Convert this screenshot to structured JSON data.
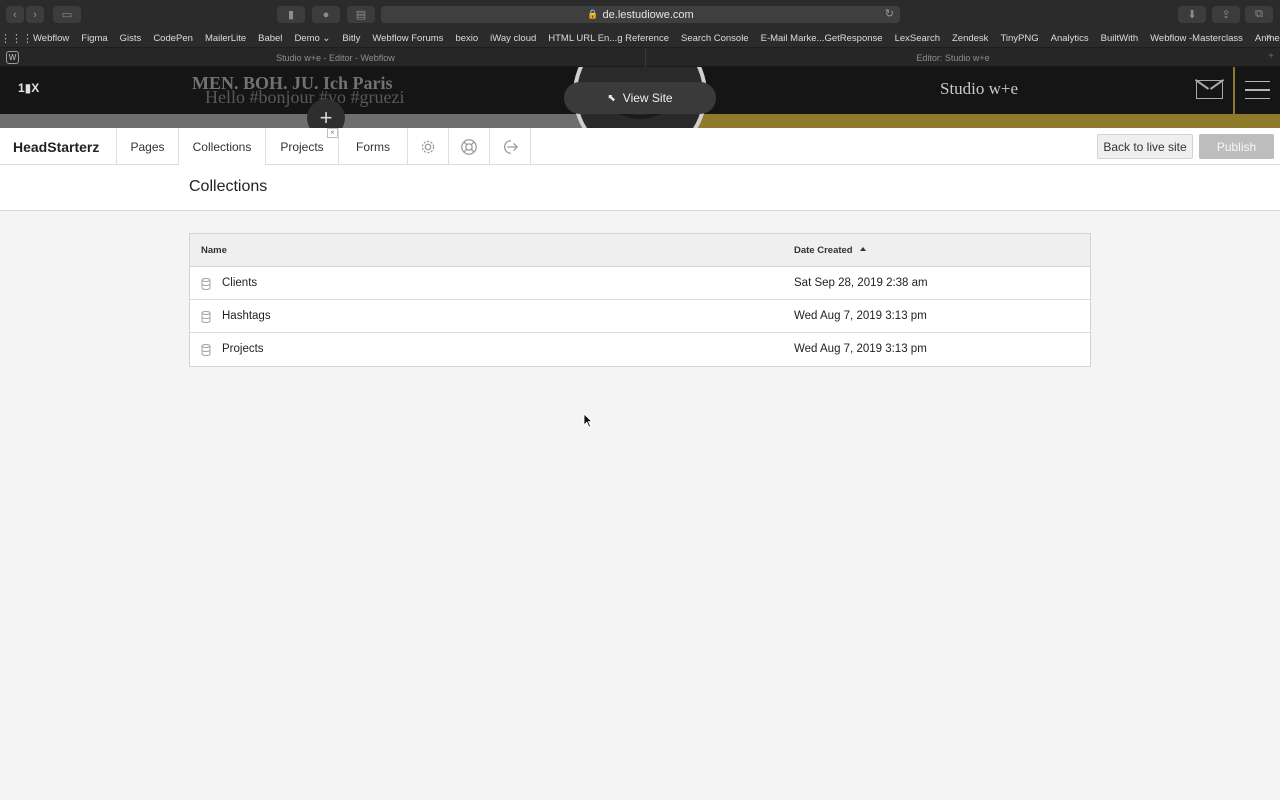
{
  "browser": {
    "url": "de.lestudiowe.com",
    "favorites": [
      "Webflow",
      "Figma",
      "Gists",
      "CodePen",
      "MailerLite",
      "Babel",
      "Demo",
      "Bitly",
      "Webflow Forums",
      "bexio",
      "iWay cloud",
      "HTML URL En...g Reference",
      "Search Console",
      "E-Mail Marke...GetResponse",
      "LexSearch",
      "Zendesk",
      "TinyPNG",
      "Analytics",
      "BuiltWith",
      "Webflow -Masterclass",
      "Anmelden"
    ],
    "tabs": [
      "Studio w+e - Editor - Webflow",
      "Editor: Studio w+e"
    ]
  },
  "site": {
    "logo": "1▮X",
    "overlap_a": "MEN. BOH. JU. Ich Paris",
    "overlap_b": "Hello #bonjour #vo #gruezi",
    "view_site": "View Site",
    "title": "Studio w+e"
  },
  "editor": {
    "brand": "HeadStarterz",
    "tabs": {
      "pages": "Pages",
      "collections": "Collections",
      "projects": "Projects",
      "forms": "Forms"
    },
    "back_to_live": "Back to live site",
    "publish": "Publish"
  },
  "page": {
    "title": "Collections"
  },
  "table": {
    "columns": {
      "name": "Name",
      "date": "Date Created"
    },
    "rows": [
      {
        "name": "Clients",
        "date": "Sat Sep 28, 2019 2:38 am"
      },
      {
        "name": "Hashtags",
        "date": "Wed Aug 7, 2019 3:13 pm"
      },
      {
        "name": "Projects",
        "date": "Wed Aug 7, 2019 3:13 pm"
      }
    ]
  },
  "colors": {
    "site_gold": "#8f7a2c",
    "publish_disabled": "#bdbdbd"
  }
}
